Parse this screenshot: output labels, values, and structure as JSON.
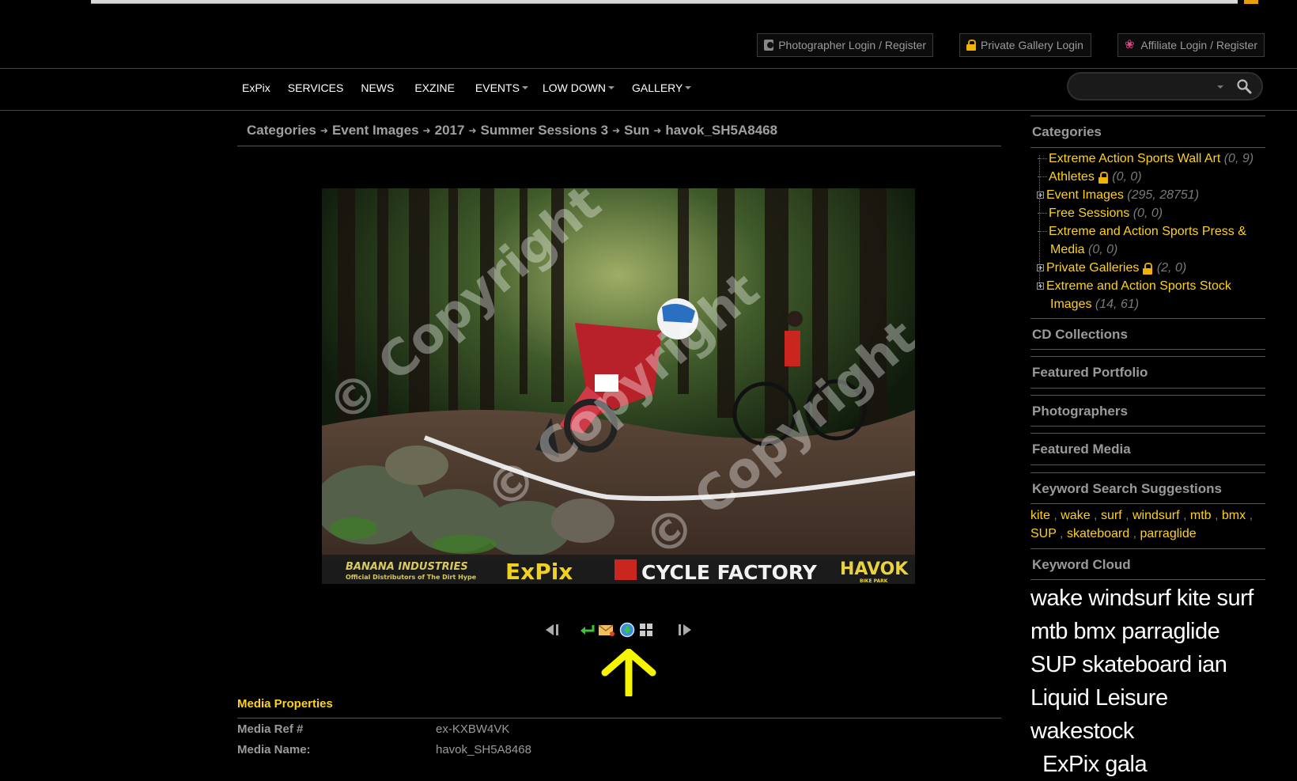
{
  "header": {
    "photographer_login": "Photographer Login / Register",
    "private_gallery_login": "Private Gallery Login",
    "affiliate_login": "Affiliate Login / Register"
  },
  "nav": {
    "items": [
      "ExPix",
      "SERVICES",
      "NEWS",
      "EXZINE",
      "EVENTS",
      "LOW DOWN",
      "GALLERY"
    ]
  },
  "search": {
    "value": "",
    "placeholder": ""
  },
  "breadcrumb": [
    "Categories",
    "Event Images",
    "2017",
    "Summer Sessions 3",
    "Sun",
    "havok_SH5A8468"
  ],
  "photo": {
    "watermark": "© Copyright",
    "sponsors": [
      "BANANA INDUSTRIES",
      "Official Distributors of The Dirt Hype",
      "ExPix",
      "CYCLE FACTORY",
      "HAVOK",
      "BIKE PARK"
    ]
  },
  "controls": [
    "prev-icon",
    "back-icon",
    "email-icon",
    "download-icon",
    "grid-icon",
    "next-icon"
  ],
  "media_properties": {
    "title": "Media Properties",
    "rows": [
      {
        "key": "Media Ref #",
        "value": "ex-KXBW4VK"
      },
      {
        "key": "Media Name:",
        "value": "havok_SH5A8468"
      }
    ]
  },
  "sidebar": {
    "categories_title": "Categories",
    "categories": [
      {
        "label": "Extreme Action Sports Wall Art",
        "count": "(0, 9)",
        "expandable": false,
        "locked": false
      },
      {
        "label": "Athletes",
        "count": "(0, 0)",
        "expandable": false,
        "locked": true
      },
      {
        "label": "Event Images",
        "count": "(295, 28751)",
        "expandable": true,
        "locked": false
      },
      {
        "label": "Free Sessions",
        "count": "(0, 0)",
        "expandable": false,
        "locked": false
      },
      {
        "label": "Extreme and Action Sports Press &",
        "label2": "Media",
        "count": "(0, 0)",
        "expandable": false,
        "locked": false
      },
      {
        "label": "Private Galleries",
        "count": "(2, 0)",
        "expandable": true,
        "locked": true
      },
      {
        "label": "Extreme and Action Sports Stock",
        "label2": "Images",
        "count": "(14, 61)",
        "expandable": true,
        "locked": false
      }
    ],
    "sections": [
      "CD Collections",
      "Featured Portfolio",
      "Photographers",
      "Featured Media",
      "Keyword Search Suggestions"
    ],
    "keywords": [
      "kite",
      "wake",
      "surf",
      "windsurf",
      "mtb",
      "bmx",
      "SUP",
      "skateboard",
      "parraglide"
    ],
    "cloud_title": "Keyword Cloud",
    "cloud_lines": [
      "wake windsurf kite surf",
      "mtb bmx parraglide",
      "SUP skateboard ian",
      "Liquid Leisure",
      "wakestock",
      "  ExPix gala"
    ]
  },
  "colors": {
    "accent": "#ffd21a",
    "annotation": "#f5f500",
    "background": "#000000"
  }
}
